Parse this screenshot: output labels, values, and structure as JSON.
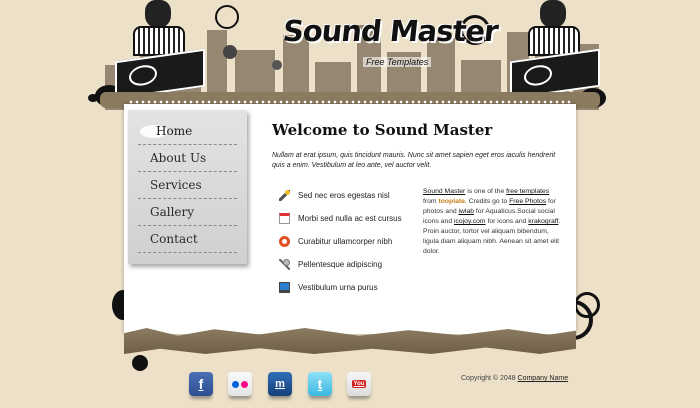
{
  "header": {
    "site_title": "Sound Master",
    "tagline": "Free Templates"
  },
  "menu": {
    "items": [
      {
        "label": "Home",
        "active": true
      },
      {
        "label": "About Us",
        "active": false
      },
      {
        "label": "Services",
        "active": false
      },
      {
        "label": "Gallery",
        "active": false
      },
      {
        "label": "Contact",
        "active": false
      }
    ]
  },
  "main": {
    "title": "Welcome to Sound Master",
    "intro": "Nullam at erat ipsum, quis tincidunt mauris. Nunc sit amet sapien eget eros iaculis hendrerit quis a enim. Vestibulum at leo ante, vel auctor velit.",
    "features": [
      {
        "icon": "magic-wand-icon",
        "label": "Sed nec eros egestas nisl"
      },
      {
        "icon": "calendar-icon",
        "label": "Morbi sed nulla ac est cursus"
      },
      {
        "icon": "lifebuoy-icon",
        "label": "Curabitur ullamcorper nibh"
      },
      {
        "icon": "microphone-icon",
        "label": "Pellentesque adipiscing"
      },
      {
        "icon": "monitor-icon",
        "label": "Vestibulum urna purus"
      }
    ],
    "side_text": {
      "link_site": "Sound Master",
      "t1": " is one of the ",
      "link_templates": "free templates",
      "t2": " from ",
      "brand": "tooplate",
      "t3": ". Credits go to ",
      "link_photos": "Free Photos",
      "t4": " for photos and ",
      "link_iwlab": "iwlab",
      "t5": " for Aquaticus.Social social icons and ",
      "link_icojoy": "icojoy.com",
      "t6": " for icons and ",
      "link_krakograff": "krakograff",
      "t7": ". Proin auctor, tortor vel aliquam bibendum, ligula diam aliquam nibh. Aenean sit amet elit dolor."
    }
  },
  "footer": {
    "social": [
      {
        "icon": "facebook-icon",
        "glyph": "f"
      },
      {
        "icon": "flickr-icon",
        "glyph": ""
      },
      {
        "icon": "myspace-icon",
        "glyph": "m"
      },
      {
        "icon": "twitter-icon",
        "glyph": "t"
      },
      {
        "icon": "youtube-icon",
        "glyph": "You"
      }
    ],
    "copyright_prefix": "Copyright © 2048 ",
    "company_link": "Company Name"
  },
  "colors": {
    "background": "#ece0c8",
    "panel": "#ffffff",
    "menu_bg": "#d9d9d9",
    "ink": "#111111",
    "brand_accent": "#c87a14"
  }
}
